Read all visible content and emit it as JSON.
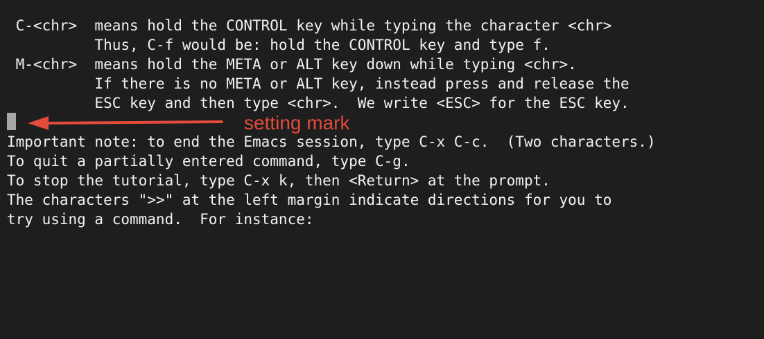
{
  "terminal": {
    "lines": [
      " C-<chr>  means hold the CONTROL key while typing the character <chr>",
      "          Thus, C-f would be: hold the CONTROL key and type f.",
      " M-<chr>  means hold the META or ALT key down while typing <chr>.",
      "          If there is no META or ALT key, instead press and release the",
      "          ESC key and then type <chr>.  We write <ESC> for the ESC key.",
      "",
      "Important note: to end the Emacs session, type C-x C-c.  (Two characters.)",
      "To quit a partially entered command, type C-g.",
      "To stop the tutorial, type C-x k, then <Return> at the prompt.",
      "The characters \">>\" at the left margin indicate directions for you to",
      "try using a command.  For instance:"
    ],
    "cursor_color": "#a7a7a7",
    "background": "#1e1e1e",
    "text_color": "#f2f2f2"
  },
  "annotation": {
    "label": "setting mark",
    "color": "#e34b3b",
    "icon": "left-arrow-icon"
  }
}
